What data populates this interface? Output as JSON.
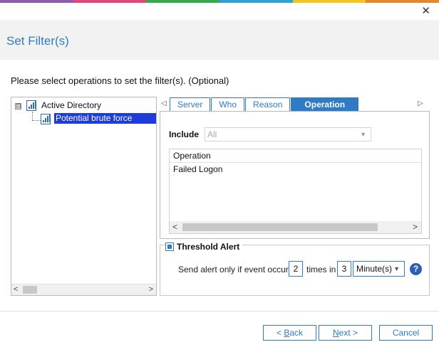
{
  "window": {
    "close_glyph": "✕",
    "title": "Set Filter(s)",
    "accent_colors": [
      "#8e5cab",
      "#e0467c",
      "#3aa84f",
      "#2f9fd6",
      "#f2c523",
      "#e4862d"
    ]
  },
  "instruction": "Please select operations to set the filter(s). (Optional)",
  "tree": {
    "expander": "⊟",
    "root_label": "Active Directory",
    "child_label": "Potential brute force attack",
    "scroll_left": "<",
    "scroll_right": ">"
  },
  "tabs": {
    "left_arrow": "◁",
    "right_arrow": "▷",
    "items": [
      {
        "label": "Server"
      },
      {
        "label": "Who"
      },
      {
        "label": "Reason"
      },
      {
        "label": "Operation"
      }
    ],
    "active_index": 3
  },
  "include": {
    "label": "Include",
    "value": "All",
    "caret": "▼"
  },
  "operations": {
    "header": "Operation",
    "rows": [
      "Failed Logon"
    ],
    "scroll_left": "<",
    "scroll_right": ">"
  },
  "threshold": {
    "label": "Threshold Alert",
    "checked": true,
    "send_label": "Send alert only if event occurs",
    "count": "2",
    "times_label": "times in",
    "interval": "3",
    "unit": "Minute(s)",
    "caret": "▼",
    "help": "?"
  },
  "buttons": {
    "back_prefix": "< ",
    "back_key": "B",
    "back_rest": "ack",
    "next_prefix": "",
    "next_key": "N",
    "next_rest": "ext >",
    "cancel": "Cancel"
  }
}
